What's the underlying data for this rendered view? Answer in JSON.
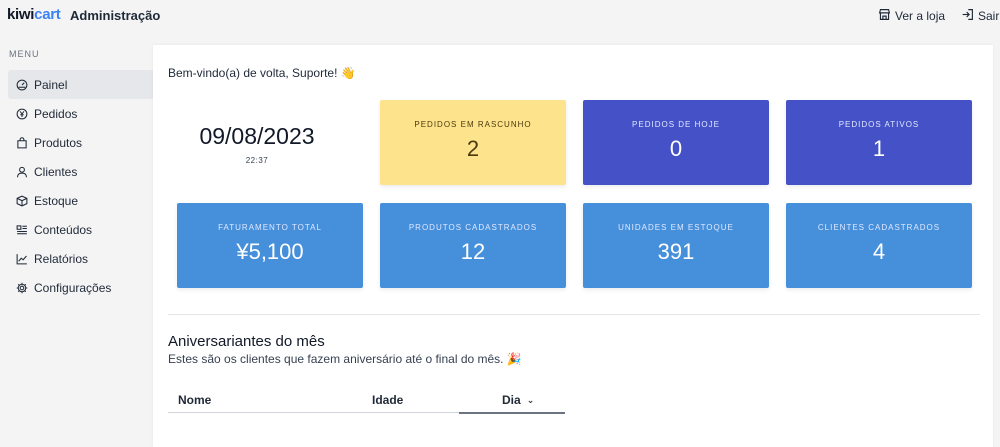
{
  "header": {
    "logo_kiwi": "kiwi",
    "logo_cart": "cart",
    "title": "Administração",
    "store_link": "Ver a loja",
    "exit_link": "Sair"
  },
  "sidebar": {
    "menu_label": "MENU",
    "items": [
      {
        "label": "Painel",
        "icon": "dashboard-icon",
        "active": true
      },
      {
        "label": "Pedidos",
        "icon": "yen-icon"
      },
      {
        "label": "Produtos",
        "icon": "bag-icon"
      },
      {
        "label": "Clientes",
        "icon": "user-icon"
      },
      {
        "label": "Estoque",
        "icon": "box-icon"
      },
      {
        "label": "Conteúdos",
        "icon": "content-icon"
      },
      {
        "label": "Relatórios",
        "icon": "chart-line-icon"
      },
      {
        "label": "Configurações",
        "icon": "gear-icon"
      }
    ]
  },
  "main": {
    "welcome": "Bem-vindo(a) de volta, Suporte! 👋",
    "date": "09/08/2023",
    "time": "22:37",
    "stats": [
      {
        "label": "PEDIDOS EM RASCUNHO",
        "value": "2",
        "color": "#fde38b"
      },
      {
        "label": "PEDIDOS DE HOJE",
        "value": "0",
        "color": "#4552c7"
      },
      {
        "label": "PEDIDOS ATIVOS",
        "value": "1",
        "color": "#4552c7"
      },
      {
        "label": "FATURAMENTO TOTAL",
        "value": "¥5,100",
        "color": "#4690db"
      },
      {
        "label": "PRODUTOS CADASTRADOS",
        "value": "12",
        "color": "#4690db"
      },
      {
        "label": "UNIDADES EM ESTOQUE",
        "value": "391",
        "color": "#4690db"
      },
      {
        "label": "CLIENTES CADASTRADOS",
        "value": "4",
        "color": "#4690db"
      }
    ],
    "birthdays": {
      "title": "Aniversariantes do mês",
      "subtitle": "Estes são os clientes que fazem aniversário até o final do mês. 🎉",
      "columns": [
        "Nome",
        "Idade",
        "Dia"
      ]
    }
  }
}
